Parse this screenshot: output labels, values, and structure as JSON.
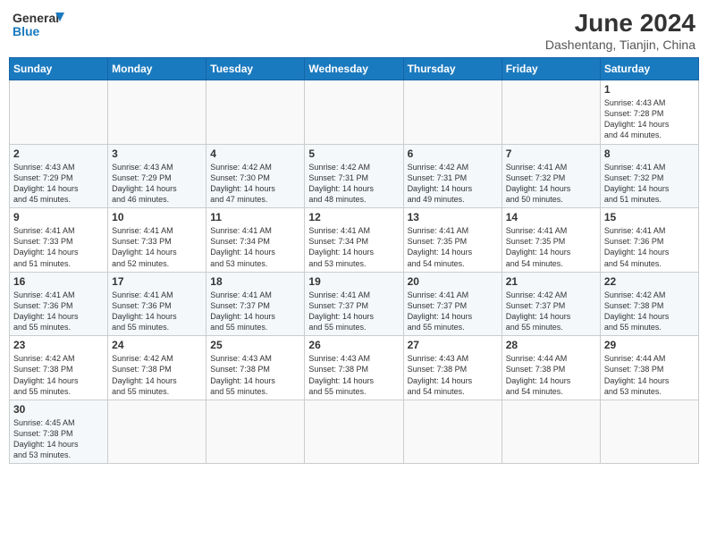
{
  "logo": {
    "text_general": "General",
    "text_blue": "Blue"
  },
  "title": "June 2024",
  "subtitle": "Dashentang, Tianjin, China",
  "days_of_week": [
    "Sunday",
    "Monday",
    "Tuesday",
    "Wednesday",
    "Thursday",
    "Friday",
    "Saturday"
  ],
  "weeks": [
    [
      {
        "day": "",
        "info": ""
      },
      {
        "day": "",
        "info": ""
      },
      {
        "day": "",
        "info": ""
      },
      {
        "day": "",
        "info": ""
      },
      {
        "day": "",
        "info": ""
      },
      {
        "day": "",
        "info": ""
      },
      {
        "day": "1",
        "info": "Sunrise: 4:43 AM\nSunset: 7:28 PM\nDaylight: 14 hours\nand 44 minutes."
      }
    ],
    [
      {
        "day": "2",
        "info": "Sunrise: 4:43 AM\nSunset: 7:29 PM\nDaylight: 14 hours\nand 45 minutes."
      },
      {
        "day": "3",
        "info": "Sunrise: 4:43 AM\nSunset: 7:29 PM\nDaylight: 14 hours\nand 46 minutes."
      },
      {
        "day": "4",
        "info": "Sunrise: 4:42 AM\nSunset: 7:30 PM\nDaylight: 14 hours\nand 47 minutes."
      },
      {
        "day": "5",
        "info": "Sunrise: 4:42 AM\nSunset: 7:31 PM\nDaylight: 14 hours\nand 48 minutes."
      },
      {
        "day": "6",
        "info": "Sunrise: 4:42 AM\nSunset: 7:31 PM\nDaylight: 14 hours\nand 49 minutes."
      },
      {
        "day": "7",
        "info": "Sunrise: 4:41 AM\nSunset: 7:32 PM\nDaylight: 14 hours\nand 50 minutes."
      },
      {
        "day": "8",
        "info": "Sunrise: 4:41 AM\nSunset: 7:32 PM\nDaylight: 14 hours\nand 51 minutes."
      }
    ],
    [
      {
        "day": "9",
        "info": "Sunrise: 4:41 AM\nSunset: 7:33 PM\nDaylight: 14 hours\nand 51 minutes."
      },
      {
        "day": "10",
        "info": "Sunrise: 4:41 AM\nSunset: 7:33 PM\nDaylight: 14 hours\nand 52 minutes."
      },
      {
        "day": "11",
        "info": "Sunrise: 4:41 AM\nSunset: 7:34 PM\nDaylight: 14 hours\nand 53 minutes."
      },
      {
        "day": "12",
        "info": "Sunrise: 4:41 AM\nSunset: 7:34 PM\nDaylight: 14 hours\nand 53 minutes."
      },
      {
        "day": "13",
        "info": "Sunrise: 4:41 AM\nSunset: 7:35 PM\nDaylight: 14 hours\nand 54 minutes."
      },
      {
        "day": "14",
        "info": "Sunrise: 4:41 AM\nSunset: 7:35 PM\nDaylight: 14 hours\nand 54 minutes."
      },
      {
        "day": "15",
        "info": "Sunrise: 4:41 AM\nSunset: 7:36 PM\nDaylight: 14 hours\nand 54 minutes."
      }
    ],
    [
      {
        "day": "16",
        "info": "Sunrise: 4:41 AM\nSunset: 7:36 PM\nDaylight: 14 hours\nand 55 minutes."
      },
      {
        "day": "17",
        "info": "Sunrise: 4:41 AM\nSunset: 7:36 PM\nDaylight: 14 hours\nand 55 minutes."
      },
      {
        "day": "18",
        "info": "Sunrise: 4:41 AM\nSunset: 7:37 PM\nDaylight: 14 hours\nand 55 minutes."
      },
      {
        "day": "19",
        "info": "Sunrise: 4:41 AM\nSunset: 7:37 PM\nDaylight: 14 hours\nand 55 minutes."
      },
      {
        "day": "20",
        "info": "Sunrise: 4:41 AM\nSunset: 7:37 PM\nDaylight: 14 hours\nand 55 minutes."
      },
      {
        "day": "21",
        "info": "Sunrise: 4:42 AM\nSunset: 7:37 PM\nDaylight: 14 hours\nand 55 minutes."
      },
      {
        "day": "22",
        "info": "Sunrise: 4:42 AM\nSunset: 7:38 PM\nDaylight: 14 hours\nand 55 minutes."
      }
    ],
    [
      {
        "day": "23",
        "info": "Sunrise: 4:42 AM\nSunset: 7:38 PM\nDaylight: 14 hours\nand 55 minutes."
      },
      {
        "day": "24",
        "info": "Sunrise: 4:42 AM\nSunset: 7:38 PM\nDaylight: 14 hours\nand 55 minutes."
      },
      {
        "day": "25",
        "info": "Sunrise: 4:43 AM\nSunset: 7:38 PM\nDaylight: 14 hours\nand 55 minutes."
      },
      {
        "day": "26",
        "info": "Sunrise: 4:43 AM\nSunset: 7:38 PM\nDaylight: 14 hours\nand 55 minutes."
      },
      {
        "day": "27",
        "info": "Sunrise: 4:43 AM\nSunset: 7:38 PM\nDaylight: 14 hours\nand 54 minutes."
      },
      {
        "day": "28",
        "info": "Sunrise: 4:44 AM\nSunset: 7:38 PM\nDaylight: 14 hours\nand 54 minutes."
      },
      {
        "day": "29",
        "info": "Sunrise: 4:44 AM\nSunset: 7:38 PM\nDaylight: 14 hours\nand 53 minutes."
      }
    ],
    [
      {
        "day": "30",
        "info": "Sunrise: 4:45 AM\nSunset: 7:38 PM\nDaylight: 14 hours\nand 53 minutes."
      },
      {
        "day": "",
        "info": ""
      },
      {
        "day": "",
        "info": ""
      },
      {
        "day": "",
        "info": ""
      },
      {
        "day": "",
        "info": ""
      },
      {
        "day": "",
        "info": ""
      },
      {
        "day": "",
        "info": ""
      }
    ]
  ]
}
